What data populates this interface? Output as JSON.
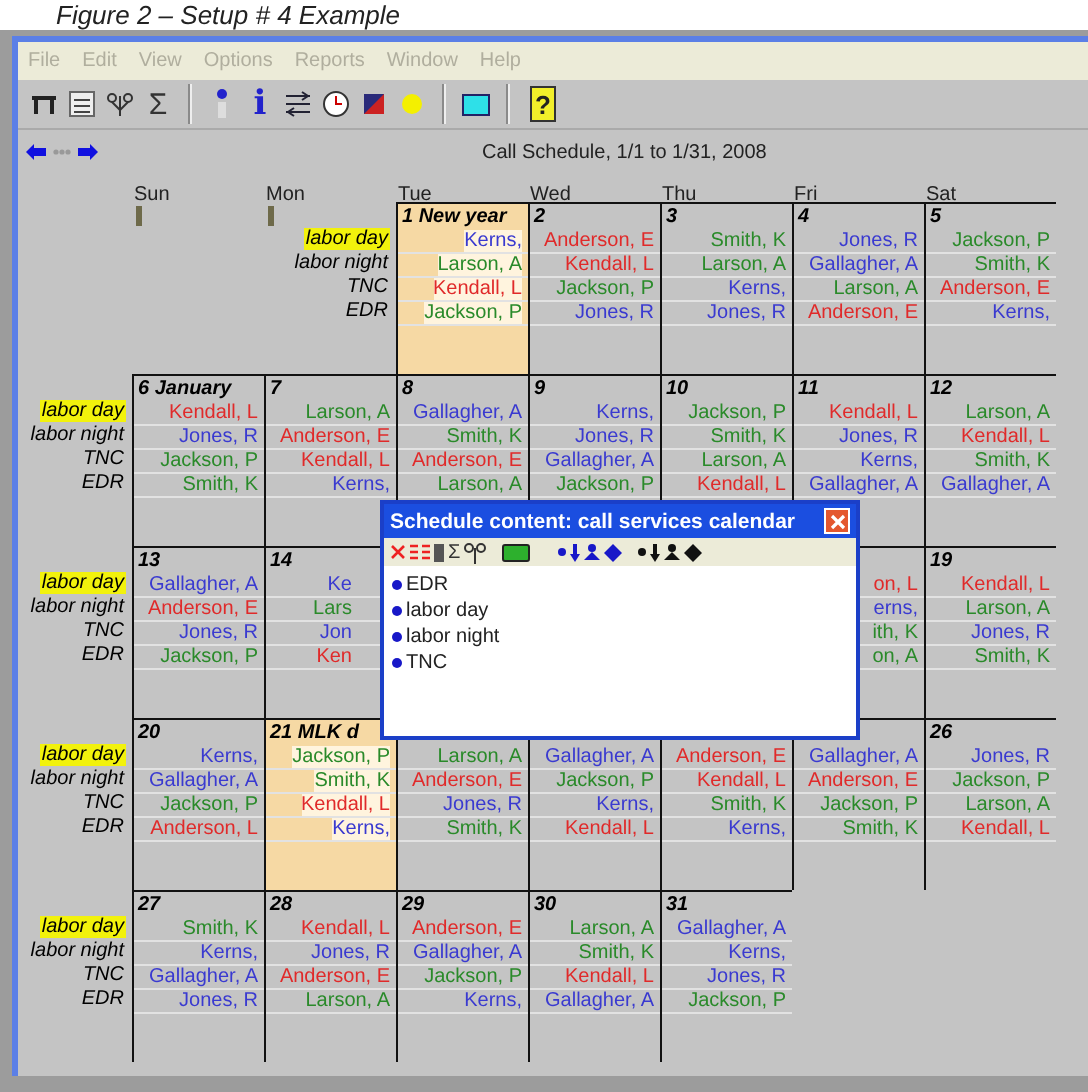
{
  "caption": "Figure 2 – Setup # 4 Example",
  "menu": [
    {
      "label": "File",
      "disabled": true
    },
    {
      "label": "Edit",
      "disabled": true
    },
    {
      "label": "View",
      "disabled": true
    },
    {
      "label": "Options",
      "disabled": true
    },
    {
      "label": "Reports",
      "disabled": true
    },
    {
      "label": "Window",
      "disabled": true
    },
    {
      "label": "Help",
      "disabled": true
    }
  ],
  "toolbar": {
    "sigma": "Σ",
    "info": "i",
    "help": "?"
  },
  "schedule_title": "Call Schedule, 1/1 to 1/31, 2008",
  "weekdays": [
    "Sun",
    "Mon",
    "Tue",
    "Wed",
    "Thu",
    "Fri",
    "Sat"
  ],
  "weeks": [
    {
      "days": [
        {
          "kind": "blank"
        },
        {
          "kind": "labels",
          "labels": [
            {
              "text": "labor day",
              "highlight": true
            },
            {
              "text": "labor night",
              "highlight": false
            },
            {
              "text": "TNC",
              "highlight": false
            },
            {
              "text": "EDR",
              "highlight": false
            }
          ]
        },
        {
          "kind": "day",
          "date": "1 New year",
          "holiday": true,
          "names": [
            {
              "text": "Kerns,",
              "color": "#3a3ad0"
            },
            {
              "text": "Larson, A",
              "color": "#2a8a2a"
            },
            {
              "text": "Kendall, L",
              "color": "#e02a2a"
            },
            {
              "text": "Jackson, P",
              "color": "#2a8a2a"
            }
          ]
        },
        {
          "kind": "day",
          "date": "2",
          "holiday": false,
          "names": [
            {
              "text": "Anderson, E",
              "color": "#e02a2a"
            },
            {
              "text": "Kendall, L",
              "color": "#e02a2a"
            },
            {
              "text": "Jackson, P",
              "color": "#2a8a2a"
            },
            {
              "text": "Jones, R",
              "color": "#3a3ad0"
            }
          ]
        },
        {
          "kind": "day",
          "date": "3",
          "holiday": false,
          "names": [
            {
              "text": "Smith, K",
              "color": "#2a8a2a"
            },
            {
              "text": "Larson, A",
              "color": "#2a8a2a"
            },
            {
              "text": "Kerns,",
              "color": "#3a3ad0"
            },
            {
              "text": "Jones, R",
              "color": "#3a3ad0"
            }
          ]
        },
        {
          "kind": "day",
          "date": "4",
          "holiday": false,
          "names": [
            {
              "text": "Jones, R",
              "color": "#3a3ad0"
            },
            {
              "text": "Gallagher, A",
              "color": "#3a3ad0"
            },
            {
              "text": "Larson, A",
              "color": "#2a8a2a"
            },
            {
              "text": "Anderson, E",
              "color": "#e02a2a"
            }
          ]
        },
        {
          "kind": "day",
          "date": "5",
          "holiday": false,
          "names": [
            {
              "text": "Jackson, P",
              "color": "#2a8a2a"
            },
            {
              "text": "Smith, K",
              "color": "#2a8a2a"
            },
            {
              "text": "Anderson, E",
              "color": "#e02a2a"
            },
            {
              "text": "Kerns,",
              "color": "#3a3ad0"
            }
          ]
        }
      ]
    },
    {
      "labels": [
        {
          "text": "labor day",
          "highlight": true
        },
        {
          "text": "labor night",
          "highlight": false
        },
        {
          "text": "TNC",
          "highlight": false
        },
        {
          "text": "EDR",
          "highlight": false
        }
      ],
      "days": [
        {
          "kind": "day",
          "date": "6 January",
          "holiday": false,
          "names": [
            {
              "text": "Kendall, L",
              "color": "#e02a2a"
            },
            {
              "text": "Jones, R",
              "color": "#3a3ad0"
            },
            {
              "text": "Jackson, P",
              "color": "#2a8a2a"
            },
            {
              "text": "Smith, K",
              "color": "#2a8a2a"
            }
          ]
        },
        {
          "kind": "day",
          "date": "7",
          "holiday": false,
          "names": [
            {
              "text": "Larson, A",
              "color": "#2a8a2a"
            },
            {
              "text": "Anderson, E",
              "color": "#e02a2a"
            },
            {
              "text": "Kendall, L",
              "color": "#e02a2a"
            },
            {
              "text": "Kerns,",
              "color": "#3a3ad0"
            }
          ]
        },
        {
          "kind": "day",
          "date": "8",
          "holiday": false,
          "names": [
            {
              "text": "Gallagher, A",
              "color": "#3a3ad0"
            },
            {
              "text": "Smith, K",
              "color": "#2a8a2a"
            },
            {
              "text": "Anderson, E",
              "color": "#e02a2a"
            },
            {
              "text": "Larson, A",
              "color": "#2a8a2a"
            }
          ]
        },
        {
          "kind": "day",
          "date": "9",
          "holiday": false,
          "names": [
            {
              "text": "Kerns,",
              "color": "#3a3ad0"
            },
            {
              "text": "Jones, R",
              "color": "#3a3ad0"
            },
            {
              "text": "Gallagher, A",
              "color": "#3a3ad0"
            },
            {
              "text": "Jackson, P",
              "color": "#2a8a2a"
            }
          ]
        },
        {
          "kind": "day",
          "date": "10",
          "holiday": false,
          "names": [
            {
              "text": "Jackson, P",
              "color": "#2a8a2a"
            },
            {
              "text": "Smith, K",
              "color": "#2a8a2a"
            },
            {
              "text": "Larson, A",
              "color": "#2a8a2a"
            },
            {
              "text": "Kendall, L",
              "color": "#e02a2a"
            }
          ]
        },
        {
          "kind": "day",
          "date": "11",
          "holiday": false,
          "names": [
            {
              "text": "Kendall, L",
              "color": "#e02a2a"
            },
            {
              "text": "Jones, R",
              "color": "#3a3ad0"
            },
            {
              "text": "Kerns,",
              "color": "#3a3ad0"
            },
            {
              "text": "Gallagher, A",
              "color": "#3a3ad0"
            }
          ]
        },
        {
          "kind": "day",
          "date": "12",
          "holiday": false,
          "names": [
            {
              "text": "Larson, A",
              "color": "#2a8a2a"
            },
            {
              "text": "Kendall, L",
              "color": "#e02a2a"
            },
            {
              "text": "Smith, K",
              "color": "#2a8a2a"
            },
            {
              "text": "Gallagher, A",
              "color": "#3a3ad0"
            }
          ]
        }
      ]
    },
    {
      "labels": [
        {
          "text": "labor day",
          "highlight": true
        },
        {
          "text": "labor night",
          "highlight": false
        },
        {
          "text": "TNC",
          "highlight": false
        },
        {
          "text": "EDR",
          "highlight": false
        }
      ],
      "days": [
        {
          "kind": "day",
          "date": "13",
          "holiday": false,
          "names": [
            {
              "text": "Gallagher, A",
              "color": "#3a3ad0"
            },
            {
              "text": "Anderson, E",
              "color": "#e02a2a"
            },
            {
              "text": "Jones, R",
              "color": "#3a3ad0"
            },
            {
              "text": "Jackson, P",
              "color": "#2a8a2a"
            }
          ]
        },
        {
          "kind": "partial",
          "date": "14",
          "holiday": false,
          "names": [
            {
              "text": "Ke",
              "color": "#3a3ad0"
            },
            {
              "text": "Lars",
              "color": "#2a8a2a"
            },
            {
              "text": "Jon",
              "color": "#3a3ad0"
            },
            {
              "text": "Ken",
              "color": "#e02a2a"
            }
          ]
        },
        {
          "kind": "covered"
        },
        {
          "kind": "covered"
        },
        {
          "kind": "covered"
        },
        {
          "kind": "day",
          "holiday": false,
          "names": [
            {
              "text": "on, L",
              "color": "#e02a2a"
            },
            {
              "text": "erns,",
              "color": "#3a3ad0"
            },
            {
              "text": "ith, K",
              "color": "#2a8a2a"
            },
            {
              "text": "on, A",
              "color": "#2a8a2a"
            }
          ]
        },
        {
          "kind": "day",
          "date": "19",
          "holiday": false,
          "names": [
            {
              "text": "Kendall, L",
              "color": "#e02a2a"
            },
            {
              "text": "Larson, A",
              "color": "#2a8a2a"
            },
            {
              "text": "Jones, R",
              "color": "#3a3ad0"
            },
            {
              "text": "Smith, K",
              "color": "#2a8a2a"
            }
          ]
        }
      ]
    },
    {
      "labels": [
        {
          "text": "labor day",
          "highlight": true
        },
        {
          "text": "labor night",
          "highlight": false
        },
        {
          "text": "TNC",
          "highlight": false
        },
        {
          "text": "EDR",
          "highlight": false
        }
      ],
      "days": [
        {
          "kind": "day",
          "date": "20",
          "holiday": false,
          "names": [
            {
              "text": "Kerns,",
              "color": "#3a3ad0"
            },
            {
              "text": "Gallagher, A",
              "color": "#3a3ad0"
            },
            {
              "text": "Jackson, P",
              "color": "#2a8a2a"
            },
            {
              "text": "Anderson, L",
              "color": "#e02a2a"
            }
          ]
        },
        {
          "kind": "day",
          "date": "21 MLK d",
          "holiday": true,
          "names": [
            {
              "text": "Jackson, P",
              "color": "#2a8a2a"
            },
            {
              "text": "Smith, K",
              "color": "#2a8a2a"
            },
            {
              "text": "Kendall, L",
              "color": "#e02a2a"
            },
            {
              "text": "Kerns,",
              "color": "#3a3ad0"
            }
          ]
        },
        {
          "kind": "day",
          "holiday": false,
          "names": [
            {
              "text": "Larson, A",
              "color": "#2a8a2a"
            },
            {
              "text": "Anderson, E",
              "color": "#e02a2a"
            },
            {
              "text": "Jones, R",
              "color": "#3a3ad0"
            },
            {
              "text": "Smith, K",
              "color": "#2a8a2a"
            }
          ]
        },
        {
          "kind": "day",
          "holiday": false,
          "names": [
            {
              "text": "Gallagher, A",
              "color": "#3a3ad0"
            },
            {
              "text": "Jackson, P",
              "color": "#2a8a2a"
            },
            {
              "text": "Kerns,",
              "color": "#3a3ad0"
            },
            {
              "text": "Kendall, L",
              "color": "#e02a2a"
            }
          ]
        },
        {
          "kind": "day",
          "holiday": false,
          "names": [
            {
              "text": "Anderson, E",
              "color": "#e02a2a"
            },
            {
              "text": "Kendall, L",
              "color": "#e02a2a"
            },
            {
              "text": "Smith, K",
              "color": "#2a8a2a"
            },
            {
              "text": "Kerns,",
              "color": "#3a3ad0"
            }
          ]
        },
        {
          "kind": "day",
          "holiday": false,
          "names": [
            {
              "text": "Gallagher, A",
              "color": "#3a3ad0"
            },
            {
              "text": "Anderson, E",
              "color": "#e02a2a"
            },
            {
              "text": "Jackson, P",
              "color": "#2a8a2a"
            },
            {
              "text": "Smith, K",
              "color": "#2a8a2a"
            }
          ]
        },
        {
          "kind": "day",
          "date": "26",
          "holiday": false,
          "names": [
            {
              "text": "Jones, R",
              "color": "#3a3ad0"
            },
            {
              "text": "Jackson, P",
              "color": "#2a8a2a"
            },
            {
              "text": "Larson, A",
              "color": "#2a8a2a"
            },
            {
              "text": "Kendall, L",
              "color": "#e02a2a"
            }
          ]
        }
      ]
    },
    {
      "labels": [
        {
          "text": "labor day",
          "highlight": true
        },
        {
          "text": "labor night",
          "highlight": false
        },
        {
          "text": "TNC",
          "highlight": false
        },
        {
          "text": "EDR",
          "highlight": false
        }
      ],
      "days": [
        {
          "kind": "day",
          "date": "27",
          "holiday": false,
          "names": [
            {
              "text": "Smith, K",
              "color": "#2a8a2a"
            },
            {
              "text": "Kerns,",
              "color": "#3a3ad0"
            },
            {
              "text": "Gallagher, A",
              "color": "#3a3ad0"
            },
            {
              "text": "Jones, R",
              "color": "#3a3ad0"
            }
          ]
        },
        {
          "kind": "day",
          "date": "28",
          "holiday": false,
          "names": [
            {
              "text": "Kendall, L",
              "color": "#e02a2a"
            },
            {
              "text": "Jones, R",
              "color": "#3a3ad0"
            },
            {
              "text": "Anderson, E",
              "color": "#e02a2a"
            },
            {
              "text": "Larson, A",
              "color": "#2a8a2a"
            }
          ]
        },
        {
          "kind": "day",
          "date": "29",
          "holiday": false,
          "names": [
            {
              "text": "Anderson, E",
              "color": "#e02a2a"
            },
            {
              "text": "Gallagher, A",
              "color": "#3a3ad0"
            },
            {
              "text": "Jackson, P",
              "color": "#2a8a2a"
            },
            {
              "text": "Kerns,",
              "color": "#3a3ad0"
            }
          ]
        },
        {
          "kind": "day",
          "date": "30",
          "holiday": false,
          "names": [
            {
              "text": "Larson, A",
              "color": "#2a8a2a"
            },
            {
              "text": "Smith, K",
              "color": "#2a8a2a"
            },
            {
              "text": "Kendall, L",
              "color": "#e02a2a"
            },
            {
              "text": "Gallagher, A",
              "color": "#3a3ad0"
            }
          ]
        },
        {
          "kind": "day",
          "date": "31",
          "holiday": false,
          "names": [
            {
              "text": "Gallagher, A",
              "color": "#3a3ad0"
            },
            {
              "text": "Kerns,",
              "color": "#3a3ad0"
            },
            {
              "text": "Jones, R",
              "color": "#3a3ad0"
            },
            {
              "text": "Jackson, P",
              "color": "#2a8a2a"
            }
          ]
        },
        {
          "kind": "blank"
        },
        {
          "kind": "blank"
        }
      ]
    }
  ],
  "dialog": {
    "title": "Schedule content:  call services calendar",
    "toolbar": {
      "sigma": "Σ"
    },
    "items": [
      "EDR",
      "labor day",
      "labor night",
      "TNC"
    ]
  }
}
